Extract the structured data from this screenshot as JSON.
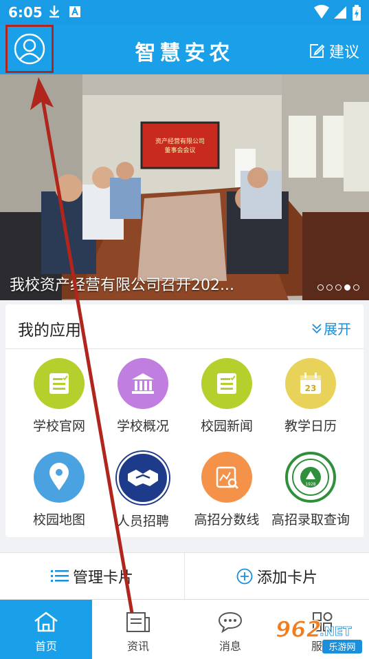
{
  "status_bar": {
    "time": "6:05"
  },
  "header": {
    "title": "智慧安农",
    "suggest_label": "建议"
  },
  "banner": {
    "caption": "我校资产经营有限公司召开202...",
    "screen_text_1": "资产经营有限公司",
    "screen_text_2": "董事会会议",
    "dots_total": 5,
    "dots_active_index": 3
  },
  "apps": {
    "title": "我的应用",
    "expand_label": "展开",
    "items": [
      {
        "label": "学校官网",
        "icon": "document-check-icon",
        "color": "#b5cf2c"
      },
      {
        "label": "学校概况",
        "icon": "institution-icon",
        "color": "#c07ee0"
      },
      {
        "label": "校园新闻",
        "icon": "news-icon",
        "color": "#b5cf2c"
      },
      {
        "label": "教学日历",
        "icon": "calendar-icon",
        "color": "#e8d25a",
        "icon_text": "23"
      },
      {
        "label": "校园地图",
        "icon": "map-pin-icon",
        "color": "#4aa3e0"
      },
      {
        "label": "人员招聘",
        "icon": "handshake-icon",
        "color": "#1e3a8a"
      },
      {
        "label": "高招分数线",
        "icon": "chart-search-icon",
        "color": "#f5924a"
      },
      {
        "label": "高招录取查询",
        "icon": "university-seal-icon",
        "color": "#2f8f3a",
        "icon_text": "1928"
      }
    ]
  },
  "card_bar": {
    "manage_label": "管理卡片",
    "add_label": "添加卡片"
  },
  "tabs": [
    {
      "label": "首页",
      "icon": "home-icon"
    },
    {
      "label": "资讯",
      "icon": "news-icon"
    },
    {
      "label": "消息",
      "icon": "message-icon"
    },
    {
      "label": "服务",
      "icon": "apps-icon"
    }
  ],
  "watermark": {
    "text_main": "962",
    "text_net": ".NET",
    "text_sub": "乐游网"
  },
  "colors": {
    "primary": "#1aa0e8",
    "highlight_box": "#b0261d",
    "annotation_arrow": "#b0261d"
  }
}
